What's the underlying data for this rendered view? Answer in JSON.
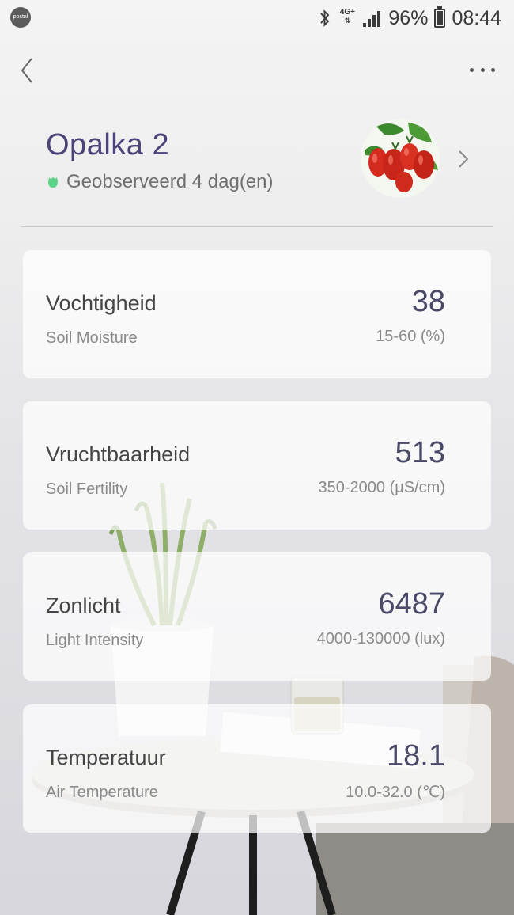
{
  "status_bar": {
    "app_icon_label": "postnl",
    "network": "4G+",
    "battery": "96%",
    "battery_level": 0.96,
    "time": "08:44"
  },
  "plant": {
    "name": "Opalka 2",
    "status": "Geobserveerd 4 dag(en)",
    "status_color": "#5fd28a",
    "accent_color": "#4a4478"
  },
  "cards": [
    {
      "title": "Vochtigheid",
      "subtitle": "Soil Moisture",
      "value": "38",
      "range": "15-60 (%)"
    },
    {
      "title": "Vruchtbaarheid",
      "subtitle": "Soil Fertility",
      "value": "513",
      "range": "350-2000 (μS/cm)"
    },
    {
      "title": "Zonlicht",
      "subtitle": "Light Intensity",
      "value": "6487",
      "range": "4000-130000 (lux)"
    },
    {
      "title": "Temperatuur",
      "subtitle": "Air Temperature",
      "value": "18.1",
      "range": "10.0-32.0 (℃)"
    }
  ]
}
